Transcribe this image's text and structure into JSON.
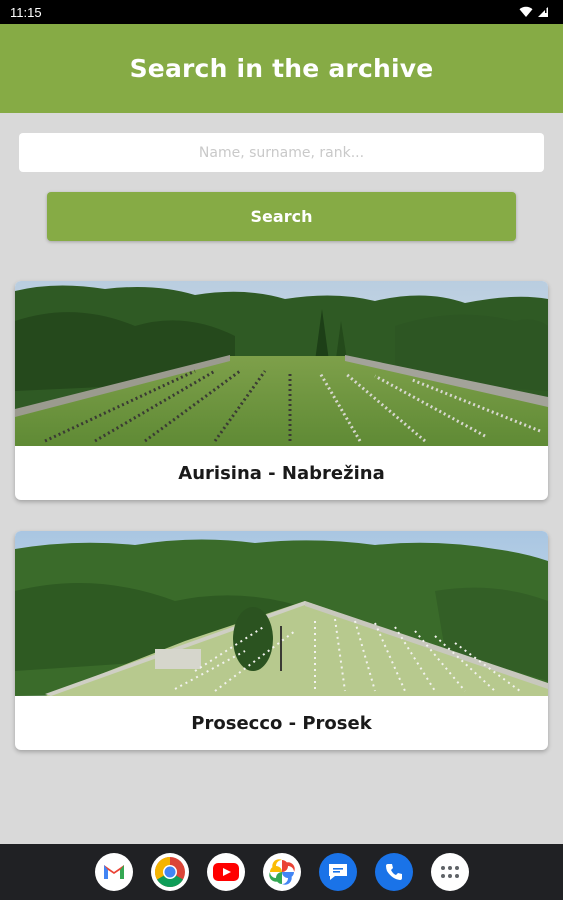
{
  "status_bar": {
    "time": "11:15"
  },
  "header": {
    "title": "Search in the archive"
  },
  "search": {
    "placeholder": "Name, surname, rank...",
    "value": "",
    "button_label": "Search"
  },
  "cemeteries": [
    {
      "name": "Aurisina - Nabrežina"
    },
    {
      "name": "Prosecco - Prosek"
    }
  ],
  "dock": [
    {
      "icon": "gmail-icon"
    },
    {
      "icon": "chrome-icon"
    },
    {
      "icon": "youtube-icon"
    },
    {
      "icon": "photos-icon"
    },
    {
      "icon": "messages-icon"
    },
    {
      "icon": "phone-icon"
    },
    {
      "icon": "app-drawer-icon"
    }
  ],
  "colors": {
    "accent": "#86ab45",
    "background": "#d9d9d9",
    "nav_bar": "#202124"
  }
}
